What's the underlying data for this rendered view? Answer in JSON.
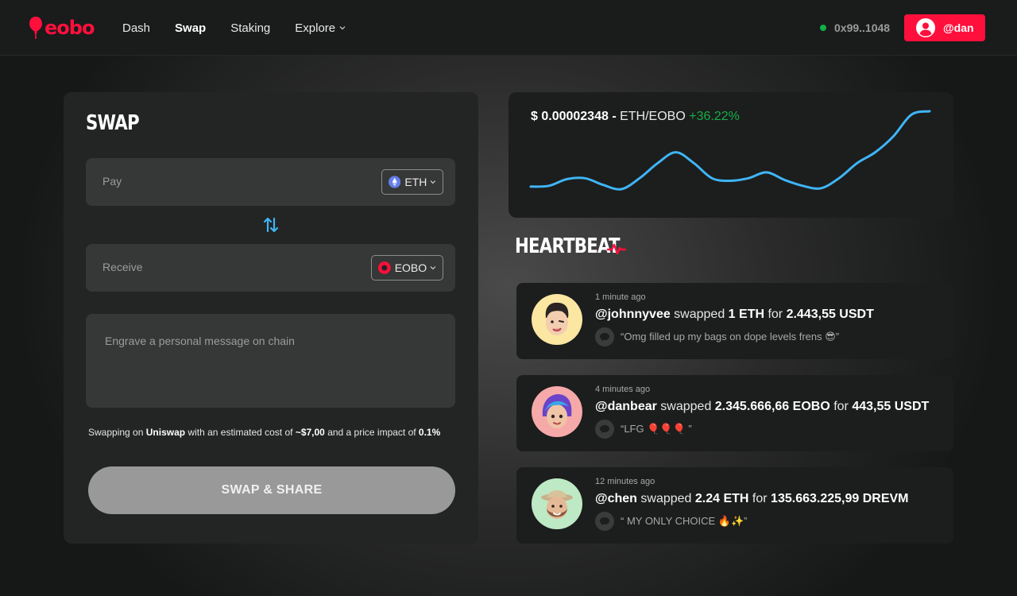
{
  "brand": {
    "name": "eobo",
    "color": "#ff0f3c"
  },
  "nav": {
    "items": [
      {
        "label": "Dash"
      },
      {
        "label": "Swap",
        "active": true
      },
      {
        "label": "Staking"
      },
      {
        "label": "Explore",
        "dropdown": true
      }
    ]
  },
  "wallet": {
    "address": "0x99..1048",
    "status_color": "#12b047"
  },
  "user": {
    "handle": "@dan"
  },
  "swap": {
    "title": "SWAP",
    "pay_label": "Pay",
    "pay_token": "ETH",
    "receive_label": "Receive",
    "receive_token": "EOBO",
    "message_placeholder": "Engrave a personal message on chain",
    "estimate": {
      "prefix": "Swapping on ",
      "venue": "Uniswap",
      "mid1": " with an estimated cost of ",
      "cost": "~$7,00",
      "mid2": " and a price impact of ",
      "impact": "0.1%"
    },
    "button_label": "SWAP & SHARE"
  },
  "price": {
    "price": "$ 0.00002348 -",
    "pair": "ETH/EOBO",
    "change": "+36.22%",
    "line_color": "#3fb5f5",
    "up_color": "#12b047"
  },
  "chart_data": {
    "type": "line",
    "series": [
      {
        "values": [
          10,
          11,
          19,
          20,
          12,
          7,
          20,
          38,
          51,
          38,
          20,
          17,
          20,
          27,
          18,
          11,
          8,
          20,
          38,
          51,
          70,
          96,
          100
        ]
      }
    ]
  },
  "heartbeat": {
    "title": "HEARTBEAT",
    "items": [
      {
        "time": "1 minute ago",
        "user": "@johnnyvee",
        "verb": " swapped ",
        "amount": "1 ETH",
        "conj": " for ",
        "result": "2.443,55 USDT",
        "message": "“Omg filled up my bags on dope levels frens 😎”",
        "avatar_bg": "#fbe6a2"
      },
      {
        "time": "4 minutes ago",
        "user": "@danbear",
        "verb": " swapped ",
        "amount": "2.345.666,66 EOBO",
        "conj": " for ",
        "result": "443,55 USDT",
        "message": "“LFG 🎈🎈🎈 ”",
        "avatar_bg": "#f6a9a9"
      },
      {
        "time": "12 minutes ago",
        "user": "@chen",
        "verb": " swapped ",
        "amount": "2.24 ETH",
        "conj": " for ",
        "result": "135.663.225,99 DREVM",
        "message": "“ MY ONLY CHOICE 🔥✨”",
        "avatar_bg": "#bde9c4"
      }
    ]
  }
}
